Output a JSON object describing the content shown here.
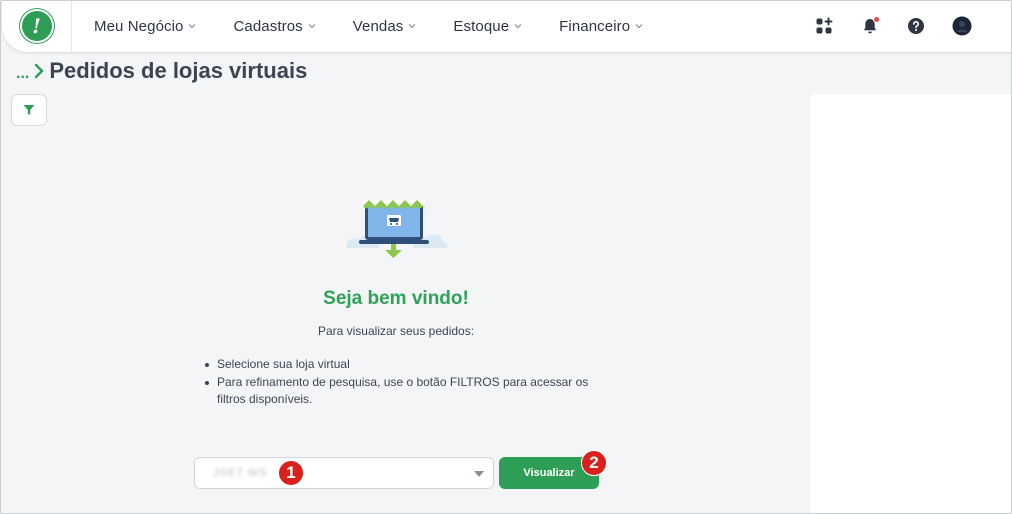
{
  "header": {
    "logo_text": "!",
    "nav": [
      {
        "label": "Meu Negócio"
      },
      {
        "label": "Cadastros"
      },
      {
        "label": "Vendas"
      },
      {
        "label": "Estoque"
      },
      {
        "label": "Financeiro"
      }
    ],
    "icons": [
      "apps-grid-icon",
      "bell-icon",
      "help-icon",
      "user-avatar-icon"
    ]
  },
  "breadcrumb": {
    "ellipsis": "...",
    "title": "Pedidos de lojas virtuais"
  },
  "welcome": {
    "title": "Seja bem vindo!",
    "subtitle": "Para visualizar seus pedidos:",
    "steps": [
      "Selecione sua loja virtual",
      "Para refinamento de pesquisa, use o botão FILTROS para acessar os filtros disponíveis."
    ]
  },
  "store_select": {
    "value": "JSET WS"
  },
  "view_button": {
    "label": "Visualizar"
  },
  "markers": [
    "1",
    "2"
  ],
  "colors": {
    "brand_green": "#2e9e57",
    "marker_red": "#d9201c",
    "notification_red": "#ef4b4b",
    "text_dark": "#3d4451"
  }
}
